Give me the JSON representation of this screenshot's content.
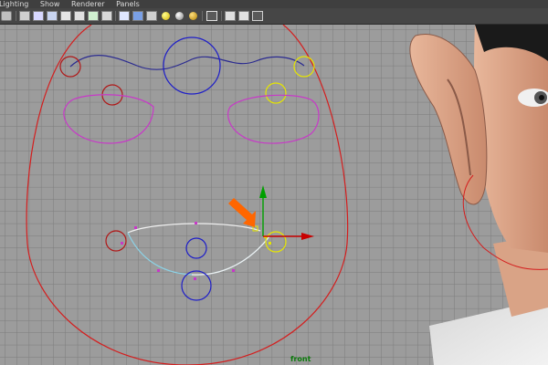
{
  "menu": {
    "items": [
      "Lighting",
      "Show",
      "Renderer",
      "Panels"
    ]
  },
  "toolbar": {
    "buttons": [
      "camera-icon",
      "bookmark-icon",
      "grid-icon",
      "wireframe-icon",
      "shaded-icon",
      "textured-icon",
      "texture-T-icon",
      "cube-icon",
      "smooth-cube-icon",
      "light-ball-icon",
      "light-ball-2-icon",
      "select-icon",
      "isolate-icon",
      "xray-icon",
      "share-icon"
    ]
  },
  "viewport": {
    "camera_label": "front",
    "colors": {
      "background": "#9c9c9c",
      "grid": "#7c7c7c",
      "face_outline": "#d41e1e",
      "brow_curve": "#2a2a90",
      "blue_control": "#1e1ec8",
      "yellow_control": "#e6e600",
      "magenta_control": "#c838c8",
      "lip_curve": "#f0f0f0",
      "lip_lower": "#8cd2e6",
      "manipulator_x": "#c80000",
      "manipulator_y": "#00a000",
      "arrow_annotation": "#ff6600"
    }
  }
}
